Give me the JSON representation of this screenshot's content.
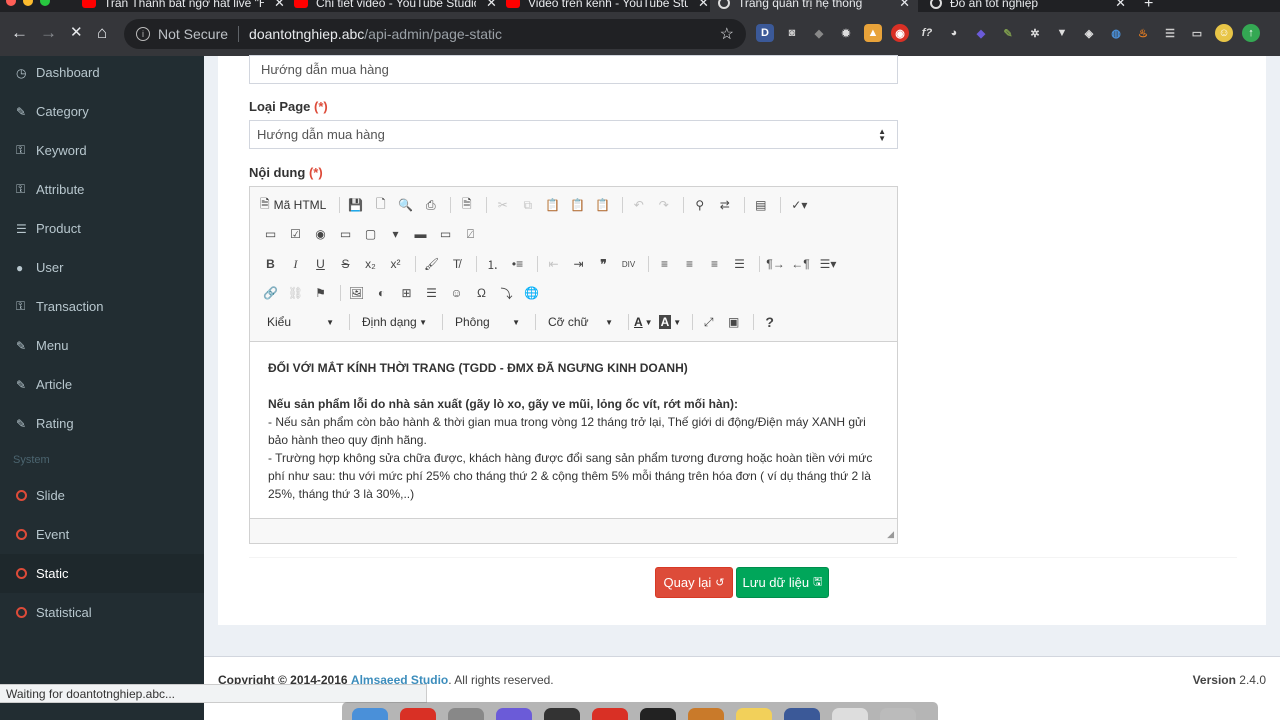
{
  "browser": {
    "tabs": [
      {
        "title": "Trấn Thành bất ngờ hát live \"H",
        "type": "youtube"
      },
      {
        "title": "Chi tiết video - YouTube Studio",
        "type": "youtube"
      },
      {
        "title": "Video trên kênh - YouTube Stu",
        "type": "youtube"
      },
      {
        "title": "Trang quản trị hệ thống",
        "type": "site",
        "active": true
      },
      {
        "title": "Đồ án tốt nghiệp",
        "type": "site"
      }
    ],
    "new_tab": "+",
    "close_glyph": "✕",
    "not_secure": "Not Secure",
    "url_host": "doantotnghiep.abc",
    "url_path": "/api-admin/page-static",
    "status_text": "Waiting for doantotnghiep.abc..."
  },
  "sidebar": {
    "items": [
      {
        "label": "Dashboard",
        "icon": "dashboard-icon",
        "glyph": "◷"
      },
      {
        "label": "Category",
        "icon": "edit-icon",
        "glyph": "✎"
      },
      {
        "label": "Keyword",
        "icon": "key-icon",
        "glyph": "⚿"
      },
      {
        "label": "Attribute",
        "icon": "key-icon",
        "glyph": "⚿"
      },
      {
        "label": "Product",
        "icon": "database-icon",
        "glyph": "☰"
      },
      {
        "label": "User",
        "icon": "user-icon",
        "glyph": "●"
      },
      {
        "label": "Transaction",
        "icon": "key-icon",
        "glyph": "⚿"
      },
      {
        "label": "Menu",
        "icon": "edit-icon",
        "glyph": "✎"
      },
      {
        "label": "Article",
        "icon": "edit-icon",
        "glyph": "✎"
      },
      {
        "label": "Rating",
        "icon": "edit-icon",
        "glyph": "✎"
      }
    ],
    "header": "System",
    "system_items": [
      {
        "label": "Slide"
      },
      {
        "label": "Event"
      },
      {
        "label": "Static",
        "active": true
      },
      {
        "label": "Statistical"
      }
    ]
  },
  "form": {
    "title_value": "Hướng dẫn mua hàng",
    "page_type_label": "Loại Page",
    "required_mark": "(*)",
    "page_type_value": "Hướng dẫn mua hàng",
    "content_label": "Nội dung"
  },
  "editor": {
    "source_label": "Mã HTML",
    "styles_combo": "Kiểu",
    "format_combo": "Định dạng",
    "font_combo": "Phông",
    "size_combo": "Cỡ chữ",
    "help": "?",
    "content": {
      "heading": "ĐỐI VỚI MẮT KÍNH THỜI TRANG (TGDD - ĐMX ĐÃ NGƯNG KINH DOANH)",
      "subheading": "Nếu sản phẩm lỗi do nhà sản xuất (gãy lò xo, gãy ve mũi, lỏng ốc vít, rớt mối hàn):",
      "line1": "- Nếu sản phẩm còn bảo hành & thời gian mua trong vòng 12 tháng trở lại, Thế giới di động/Điện máy XANH gửi bảo hành theo quy định hãng.",
      "line2": "- Trường hợp không sửa chữa được, khách hàng được đổi sang sản phẩm tương đương hoặc hoàn tiền với mức phí như sau: thu với mức phí 25% cho tháng thứ 2 & cộng thêm 5% mỗi tháng trên hóa đơn ( ví dụ tháng thứ 2 là 25%, tháng thứ 3 là 30%,..)"
    }
  },
  "buttons": {
    "back": "Quay lại",
    "save": "Lưu dữ liệu"
  },
  "footer": {
    "copyright": "Copyright © 2014-2016",
    "company": "Almsaeed Studio",
    "rights": ". All rights reserved.",
    "version_label": "Version",
    "version": "2.4.0"
  },
  "colors": {
    "sidebar_bg": "#222d32",
    "danger": "#dd4b39",
    "success": "#00a65a",
    "link": "#3c8dbc"
  }
}
